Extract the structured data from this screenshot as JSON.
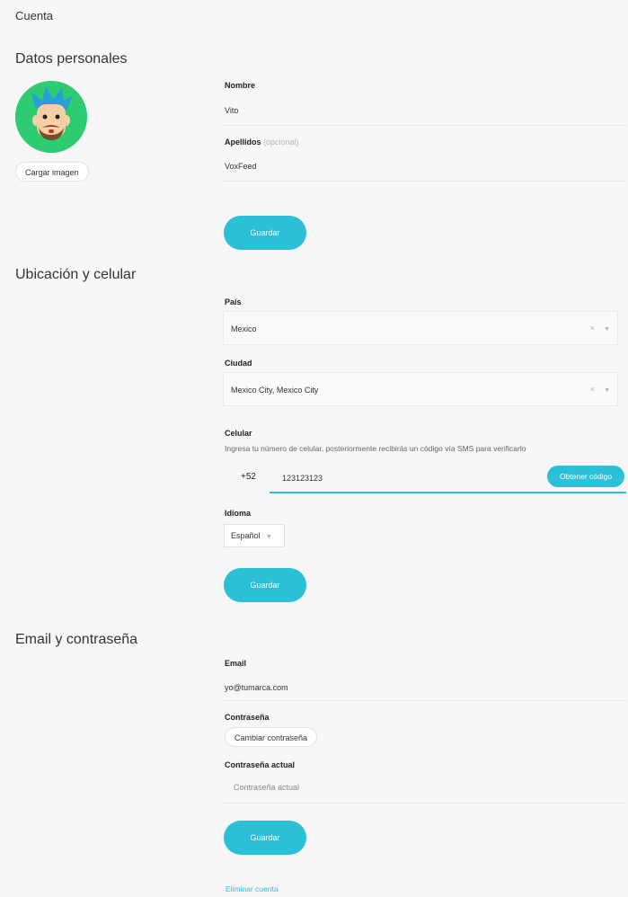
{
  "page": {
    "title": "Cuenta"
  },
  "personal": {
    "title": "Datos personales",
    "upload_label": "Cargar imagen",
    "nombre_label": "Nombre",
    "nombre_value": "Vito",
    "apellidos_label": "Apellidos",
    "apellidos_optional": "(opcional)",
    "apellidos_value": "VoxFeed",
    "save_label": "Guardar"
  },
  "location": {
    "title": "Ubicación y celular",
    "pais_label": "País",
    "pais_value": "Mexico",
    "ciudad_label": "Ciudad",
    "ciudad_value": "Mexico City, Mexico City",
    "clear_icon": "×",
    "dropdown_icon": "▼",
    "celular_label": "Celular",
    "celular_help": "Ingresa tu número de celular, posteriormente recibirás un código vía SMS para verificarlo",
    "prefix": "+52",
    "phone_value": "123123123",
    "code_button": "Obtener código",
    "idioma_label": "Idioma",
    "idioma_value": "Español",
    "save_label": "Guardar"
  },
  "credentials": {
    "title": "Email y contraseña",
    "email_label": "Email",
    "email_value": "yo@tumarca.com",
    "password_label": "Contraseña",
    "change_password": "Cambiar contraseña",
    "current_password_label": "Contraseña actual",
    "current_password_placeholder": "Contraseña actual",
    "save_label": "Guardar",
    "delete_link": "Eliminar cuenta"
  },
  "colors": {
    "accent": "#2bbfd8",
    "avatar_bg": "#2ecc71"
  }
}
